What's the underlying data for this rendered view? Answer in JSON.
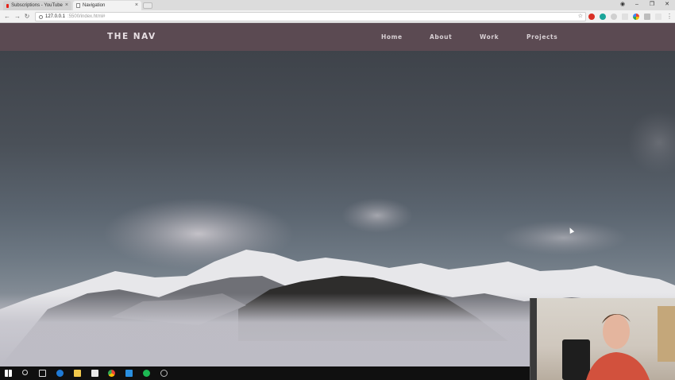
{
  "browser": {
    "tabs": [
      {
        "title": "Subscriptions - YouTube",
        "icon": "youtube-icon"
      },
      {
        "title": "Navigation",
        "icon": "document-icon"
      }
    ],
    "close_glyph": "×",
    "url_host": "127.0.0.1",
    "url_path": ":5500/index.html#",
    "window_controls": [
      "–",
      "❐",
      "✕"
    ]
  },
  "site": {
    "brand": "THE NAV",
    "menu": [
      "Home",
      "About",
      "Work",
      "Projects"
    ],
    "nav_color": "#5b4a52"
  },
  "taskbar": {
    "icons": [
      "windows-start-icon",
      "search-icon",
      "task-view-icon",
      "edge-icon",
      "file-explorer-icon",
      "mail-icon",
      "chrome-icon",
      "vscode-icon",
      "spotify-icon",
      "settings-icon"
    ]
  }
}
